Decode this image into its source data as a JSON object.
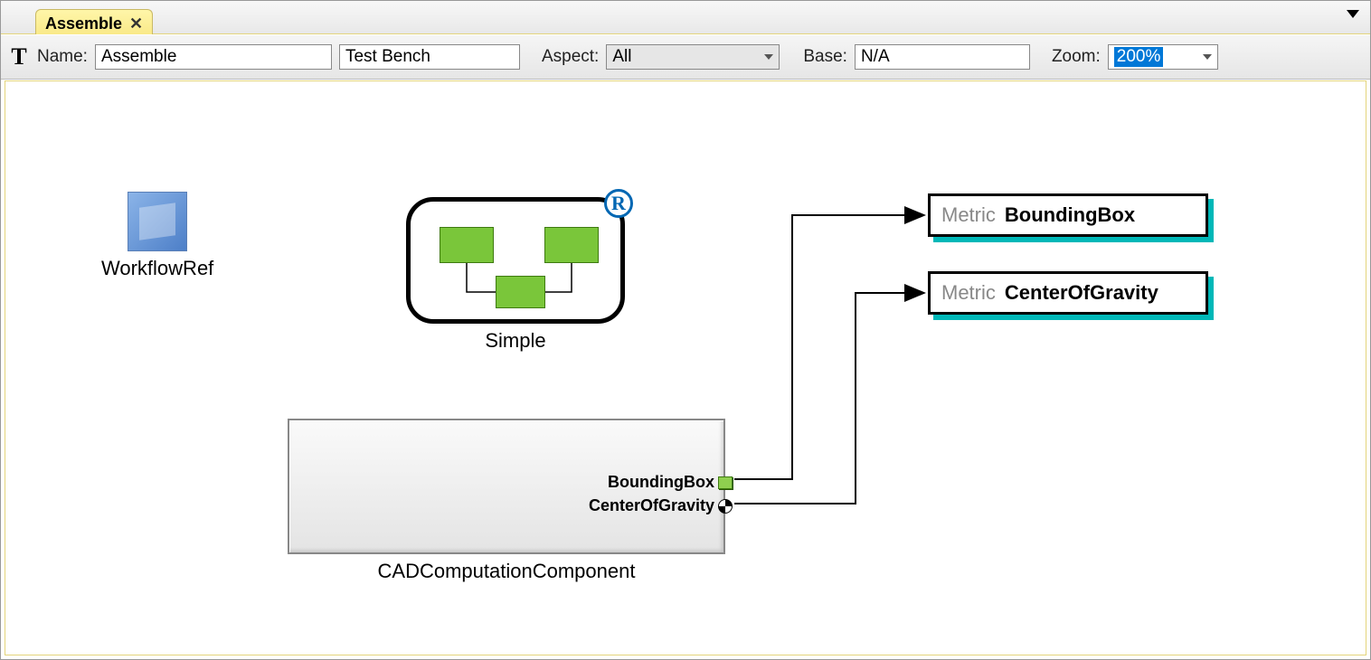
{
  "tab": {
    "title": "Assemble",
    "close_glyph": "✕"
  },
  "toolbar": {
    "t_glyph": "T",
    "name_label": "Name:",
    "name_value": "Assemble",
    "type_value": "Test Bench",
    "aspect_label": "Aspect:",
    "aspect_value": "All",
    "base_label": "Base:",
    "base_value": "N/A",
    "zoom_label": "Zoom:",
    "zoom_value": "200%"
  },
  "canvas": {
    "workflow_ref_label": "WorkflowRef",
    "simple_label": "Simple",
    "registered_glyph": "R",
    "comp_label": "CADComputationComponent",
    "ports": {
      "bb": "BoundingBox",
      "cog": "CenterOfGravity"
    },
    "metric_prefix": "Metric",
    "metrics": {
      "bb": "BoundingBox",
      "cog": "CenterOfGravity"
    }
  }
}
